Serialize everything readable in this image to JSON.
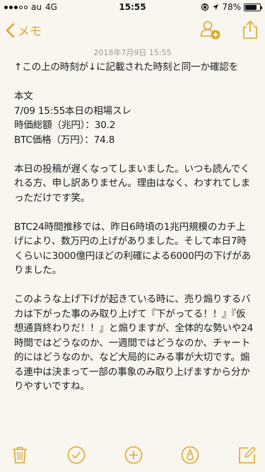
{
  "status": {
    "carrier": "au",
    "network": "4G",
    "time": "15:55",
    "battery": "78%",
    "battery_level": 0.78
  },
  "nav": {
    "back_label": "メモ",
    "accent": "#e0a62a"
  },
  "note": {
    "date": "2018年7月9日 15:55",
    "paragraphs": [
      "↑この上の時刻が↓に記載された時刻と同一か確認を",
      "本文\n7/09 15:55本日の相場スレ\n時価総額（兆円）：30.2\nBTC価格（万円）：74.8",
      "本日の投稿が遅くなってしまいました。いつも読んでくれる方、申し訳ありません。理由はなく、わすれてしまっただけです笑。",
      "BTC24時間推移では、昨日6時頃の1兆円規模のカチ上げにより、数万円の上げがありました。そして本日7時くらいに3000億円ほどの利確による6000円の下げがありました。",
      "このような上げ下げが起きている時に、売り煽りするバカは下がった事のみ取り上げて『下がってる！！』『仮想通貨終わりだ！！』と煽りますが、全体的な勢いや24時間ではどうなのか、一週間ではどうなのか、チャート的にはどうなのか、など大局的にみる事が大切です。煽る連中は決まって一部の事象のみ取り上げますから分かりやすいですね。"
    ]
  },
  "icons": {
    "share": "share-icon",
    "people": "add-people-icon",
    "trash": "trash-icon",
    "checklist": "checklist-icon",
    "add": "add-icon",
    "markup": "markup-icon",
    "compose": "compose-icon"
  }
}
